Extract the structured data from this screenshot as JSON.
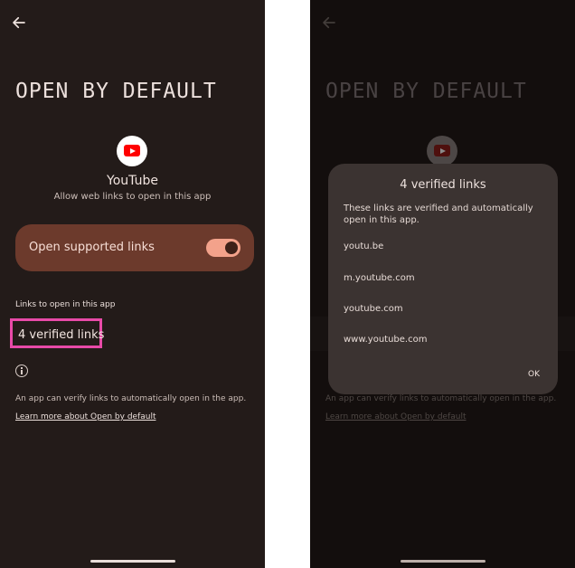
{
  "left_screen": {
    "title": "OPEN BY DEFAULT",
    "app_name": "YouTube",
    "app_description": "Allow web links to open in this app",
    "toggle_label": "Open supported links",
    "toggle_on": true,
    "section_label": "Links to open in this app",
    "verified_links": "4 verified links",
    "info_text": "An app can verify links to automatically open in the app.",
    "learn_more": "Learn more about Open by default"
  },
  "right_screen": {
    "title": "OPEN BY DEFAULT",
    "info_text": "An app can verify links to automatically open in the app.",
    "learn_more": "Learn more about Open by default",
    "dialog": {
      "title": "4 verified links",
      "body": "These links are verified and automatically open in this app.",
      "links": [
        "youtu.be",
        "m.youtube.com",
        "youtube.com",
        "www.youtube.com"
      ],
      "ok_label": "OK"
    }
  },
  "colors": {
    "background": "#231b19",
    "card": "#6c3a2c",
    "toggle_track": "#f3a28b",
    "highlight": "#e84aa8",
    "dialog": "#3b3331"
  },
  "icons": [
    "back-arrow-icon",
    "youtube-icon",
    "info-icon"
  ]
}
